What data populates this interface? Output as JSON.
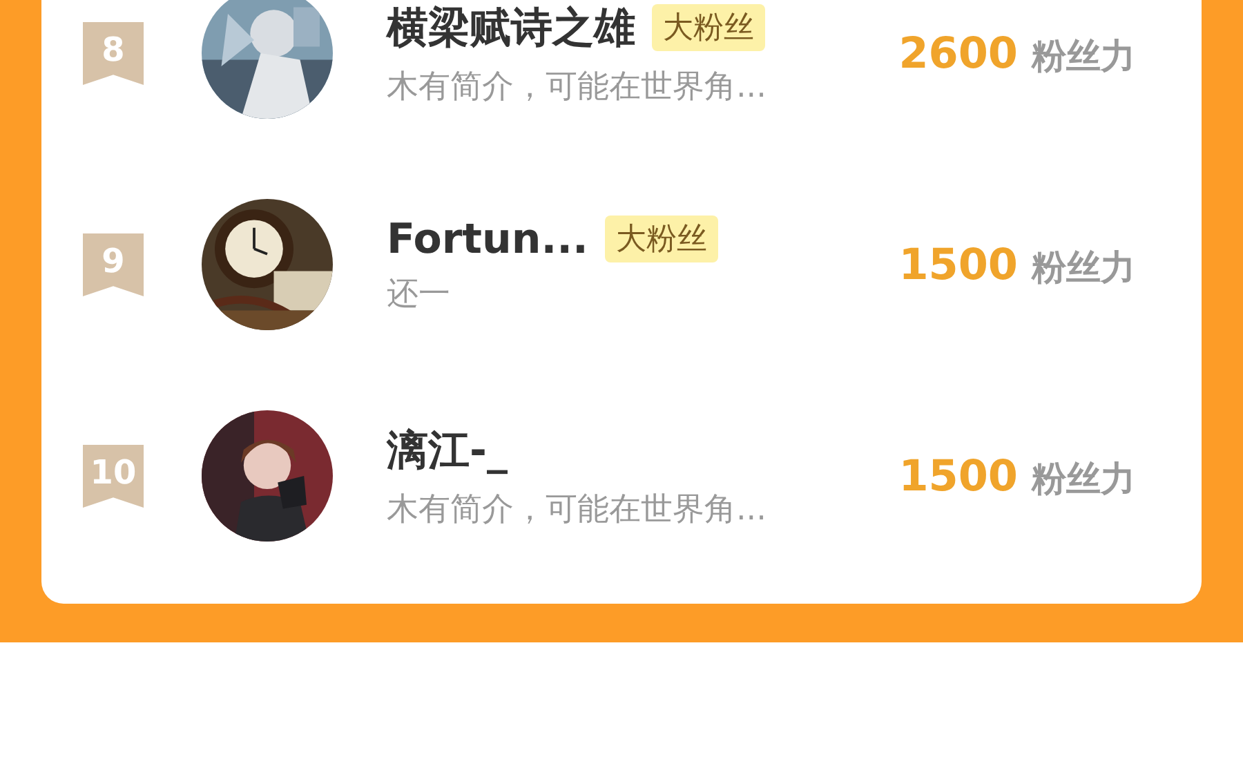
{
  "fans": [
    {
      "rank": "8",
      "name": "横梁赋诗之雄",
      "badge": "大粉丝",
      "bio": "木有简介，可能在世界角...",
      "score": "2600",
      "score_unit": "粉丝力"
    },
    {
      "rank": "9",
      "name": "Fortun...",
      "badge": "大粉丝",
      "bio": "还一",
      "score": "1500",
      "score_unit": "粉丝力"
    },
    {
      "rank": "10",
      "name": "漓江-_",
      "bio": "木有简介，可能在世界角...",
      "score": "1500",
      "score_unit": "粉丝力"
    }
  ]
}
